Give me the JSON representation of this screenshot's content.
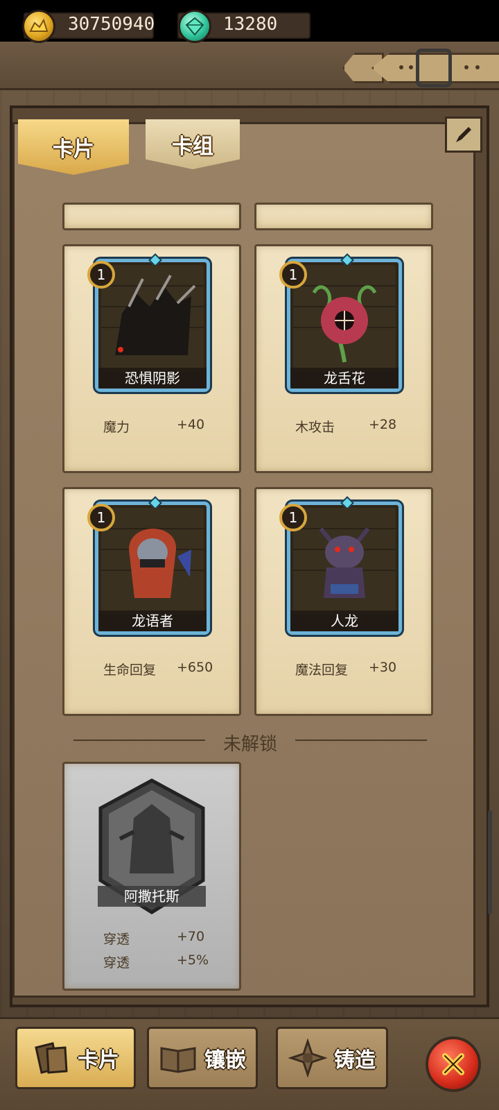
{
  "currency": {
    "gold": "30750940",
    "gems": "13280"
  },
  "tabs": [
    {
      "label": "卡片",
      "active": true
    },
    {
      "label": "卡组",
      "active": false
    }
  ],
  "cards": [
    {
      "name": "恐惧阴影",
      "level": "1",
      "stat_label": "魔力",
      "stat_value": "+40"
    },
    {
      "name": "龙舌花",
      "level": "1",
      "stat_label": "木攻击",
      "stat_value": "+28"
    },
    {
      "name": "龙语者",
      "level": "1",
      "stat_label": "生命回复",
      "stat_value": "+650"
    },
    {
      "name": "人龙",
      "level": "1",
      "stat_label": "魔法回复",
      "stat_value": "+30"
    }
  ],
  "locked_section": {
    "title": "未解锁",
    "card": {
      "name": "阿撒托斯",
      "stats": [
        {
          "label": "穿透",
          "value": "+70"
        },
        {
          "label": "穿透",
          "value": "+5%"
        }
      ]
    }
  },
  "bottom_nav": [
    {
      "label": "卡片",
      "icon": "cards-icon",
      "active": true
    },
    {
      "label": "镶嵌",
      "icon": "book-icon",
      "active": false
    },
    {
      "label": "铸造",
      "icon": "forge-icon",
      "active": false
    }
  ],
  "colors": {
    "accent_gold": "#d9ad53",
    "card_border": "#6eb3d8",
    "close_red": "#d52a1a"
  }
}
